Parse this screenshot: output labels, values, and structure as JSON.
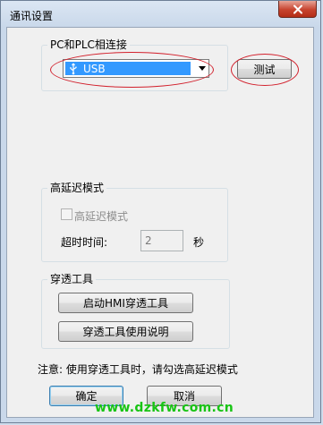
{
  "window": {
    "title": "通讯设置"
  },
  "connection": {
    "group_label": "PC和PLC相连接",
    "port_value": "USB",
    "test_button": "测试"
  },
  "latency": {
    "group_label": "高延迟模式",
    "checkbox_label": "高延迟模式",
    "checkbox_checked": false,
    "timeout_label": "超时时间:",
    "timeout_value": "2",
    "timeout_unit": "秒"
  },
  "passthrough": {
    "group_label": "穿透工具",
    "start_button": "启动HMI穿透工具",
    "help_button": "穿透工具使用说明"
  },
  "note": "注意: 使用穿透工具时，请勾选高延迟模式",
  "footer": {
    "ok_button": "确定",
    "cancel_button": "取消"
  },
  "watermark": "www.dzkfw.com.cn",
  "colors": {
    "selection": "#3399ff",
    "annotation": "#d21f2b",
    "watermark": "#18c414",
    "close": "#c7432e"
  }
}
